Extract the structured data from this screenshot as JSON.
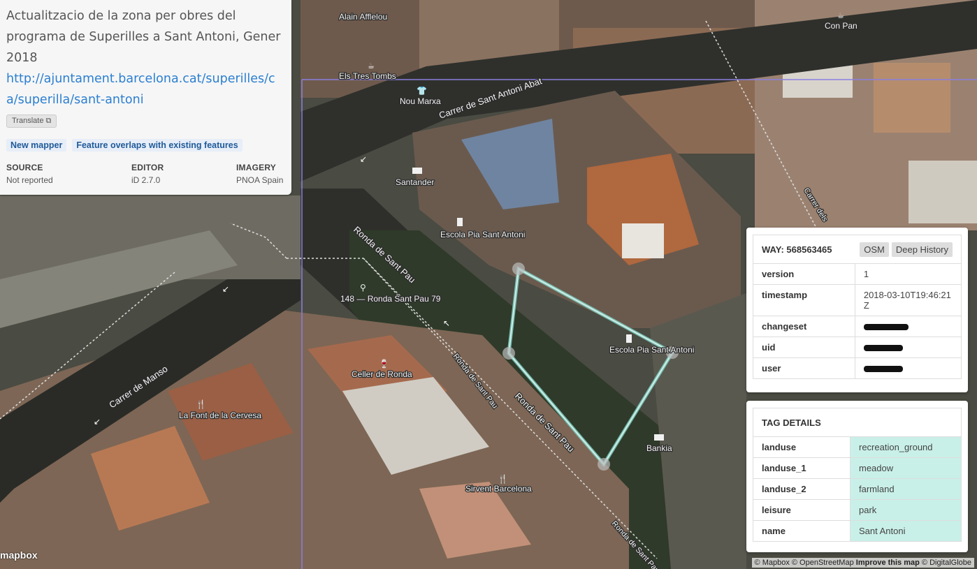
{
  "changeset": {
    "comment": "Actualitzacio de la zona per obres del programa de Superilles a Sant Antoni, Gener 2018",
    "url": "http://ajuntament.barcelona.cat/superilles/ca/superilla/sant-antoni",
    "translate_label": "Translate",
    "flags": [
      "New mapper",
      "Feature overlaps with existing features"
    ],
    "source_label": "SOURCE",
    "source_value": "Not reported",
    "editor_label": "EDITOR",
    "editor_value": "iD 2.7.0",
    "imagery_label": "IMAGERY",
    "imagery_value": "PNOA Spain"
  },
  "map": {
    "pois": [
      "Alain Afflelou",
      "Els Tres Tombs",
      "Nou Marxa",
      "Santander",
      "Escola Pia Sant Antoni",
      "148 — Ronda Sant Pau 79",
      "Celler de Ronda",
      "La Font de la Cervesa",
      "Escola Pia Sant Antoni",
      "Bankia",
      "Sirvent Barcelona",
      "Con Pan"
    ],
    "streets": [
      "Carrer de Sant Antoni Abat",
      "Ronda de Sant Pau",
      "Ronda de Sant Pau",
      "Ronda de Sant Pau",
      "Ronda de Sant Pau",
      "Carrer de Manso",
      "Carrer dels"
    ],
    "highlight_color": "#7fd6c8",
    "colors": {
      "bbox_outline": "#8a7fe0",
      "panel_accent": "#c9f0e8",
      "link": "#2b7fd1"
    }
  },
  "way": {
    "title": "WAY: 568563465",
    "osm_button": "OSM",
    "deep_history_button": "Deep History",
    "rows": [
      {
        "key": "version",
        "value": "1"
      },
      {
        "key": "timestamp",
        "value": "2018-03-10T19:46:21Z"
      },
      {
        "key": "changeset",
        "value": ""
      },
      {
        "key": "uid",
        "value": ""
      },
      {
        "key": "user",
        "value": ""
      }
    ]
  },
  "tags": {
    "title": "TAG DETAILS",
    "rows": [
      {
        "key": "landuse",
        "value": "recreation_ground"
      },
      {
        "key": "landuse_1",
        "value": "meadow"
      },
      {
        "key": "landuse_2",
        "value": "farmland"
      },
      {
        "key": "leisure",
        "value": "park"
      },
      {
        "key": "name",
        "value": "Sant Antoni"
      }
    ]
  },
  "attribution": {
    "text": "© Mapbox © OpenStreetMap",
    "improve": "Improve this map",
    "imagery": "© DigitalGlobe"
  },
  "logo": "mapbox"
}
